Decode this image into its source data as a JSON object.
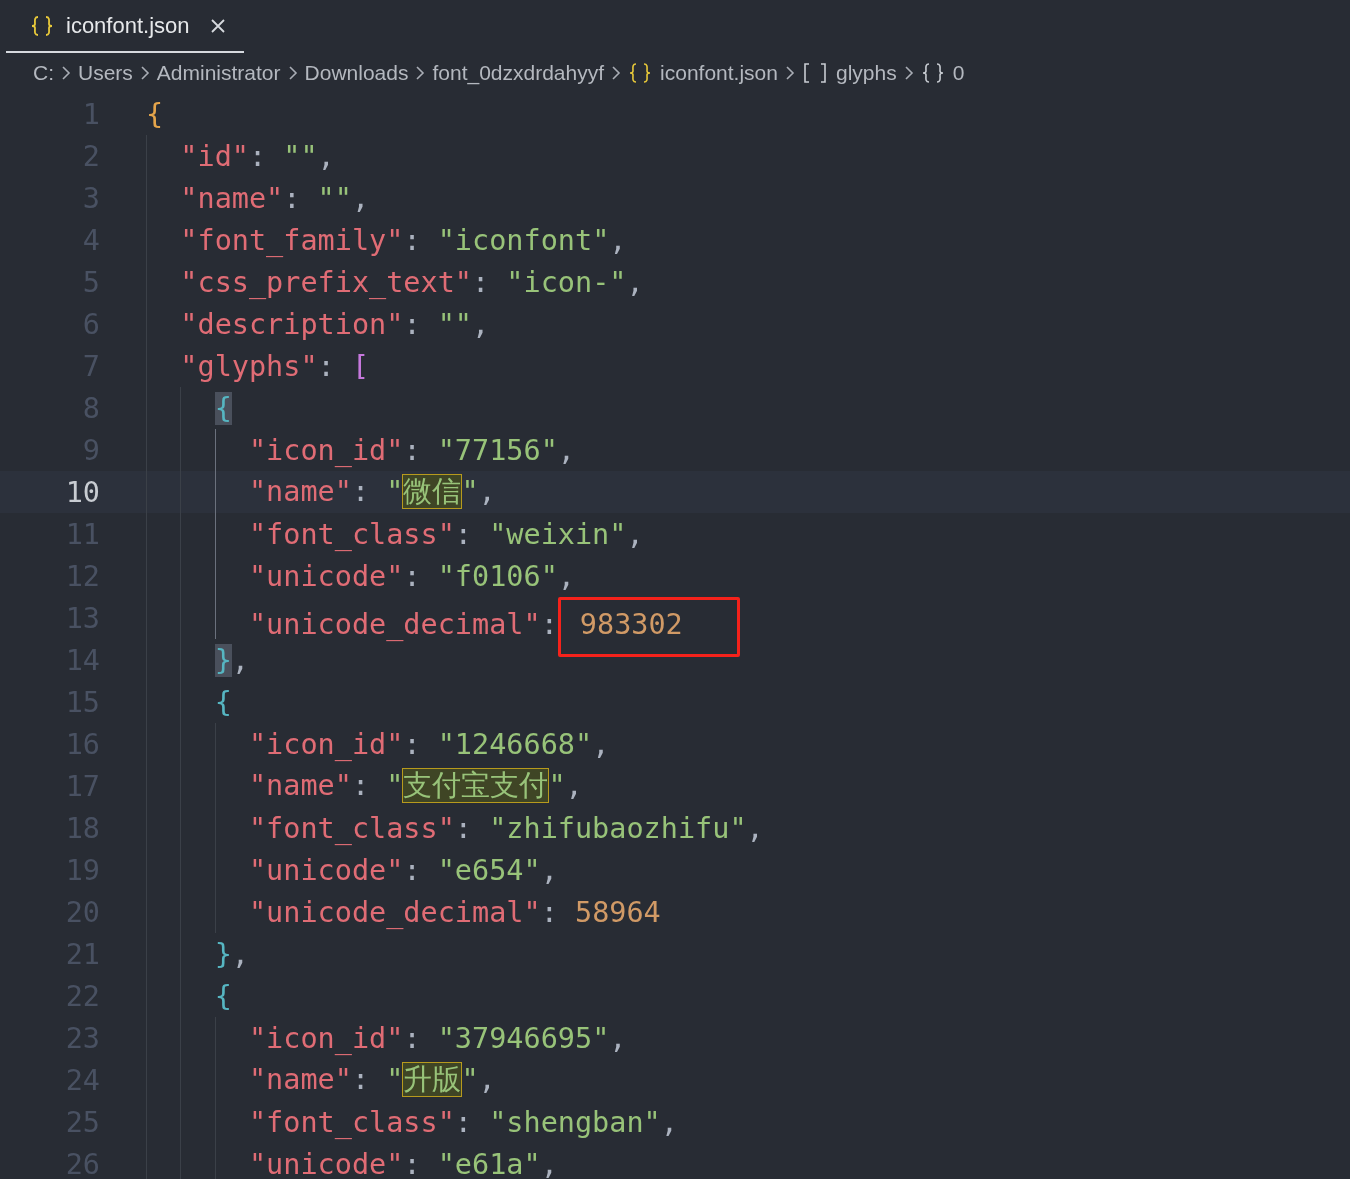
{
  "tab": {
    "title": "iconfont.json",
    "selected": true
  },
  "breadcrumbs": [
    {
      "kind": "plain",
      "label": "C:"
    },
    {
      "kind": "plain",
      "label": "Users"
    },
    {
      "kind": "plain",
      "label": "Administrator"
    },
    {
      "kind": "plain",
      "label": "Downloads"
    },
    {
      "kind": "plain",
      "label": "font_0dzxdrdahyyf"
    },
    {
      "kind": "file",
      "label": "iconfont.json"
    },
    {
      "kind": "array",
      "label": "glyphs"
    },
    {
      "kind": "object",
      "label": "0"
    }
  ],
  "lines": [
    {
      "number": "1",
      "current": false,
      "tokens": [
        {
          "kind": "open1",
          "text": "{"
        }
      ]
    },
    {
      "number": "2",
      "current": false,
      "tokens": [
        {
          "kind": "key",
          "text": "\"id\""
        },
        {
          "kind": "p",
          "text": ": "
        },
        {
          "kind": "str",
          "text": "\"\""
        },
        {
          "kind": "p",
          "text": ","
        }
      ]
    },
    {
      "number": "3",
      "current": false,
      "tokens": [
        {
          "kind": "key",
          "text": "\"name\""
        },
        {
          "kind": "p",
          "text": ": "
        },
        {
          "kind": "str",
          "text": "\"\""
        },
        {
          "kind": "p",
          "text": ","
        }
      ]
    },
    {
      "number": "4",
      "current": false,
      "tokens": [
        {
          "kind": "key",
          "text": "\"font_family\""
        },
        {
          "kind": "p",
          "text": ": "
        },
        {
          "kind": "str",
          "text": "\"iconfont\""
        },
        {
          "kind": "p",
          "text": ","
        }
      ]
    },
    {
      "number": "5",
      "current": false,
      "tokens": [
        {
          "kind": "key",
          "text": "\"css_prefix_text\""
        },
        {
          "kind": "p",
          "text": ": "
        },
        {
          "kind": "str",
          "text": "\"icon-\""
        },
        {
          "kind": "p",
          "text": ","
        }
      ]
    },
    {
      "number": "6",
      "current": false,
      "tokens": [
        {
          "kind": "key",
          "text": "\"description\""
        },
        {
          "kind": "p",
          "text": ": "
        },
        {
          "kind": "str",
          "text": "\"\""
        },
        {
          "kind": "p",
          "text": ","
        }
      ]
    },
    {
      "number": "7",
      "current": false,
      "tokens": [
        {
          "kind": "key",
          "text": "\"glyphs\""
        },
        {
          "kind": "p",
          "text": ": "
        },
        {
          "kind": "open2",
          "text": "["
        }
      ]
    },
    {
      "number": "8",
      "current": false,
      "tokens": [
        {
          "kind": "match_open",
          "text": "{"
        }
      ]
    },
    {
      "number": "9",
      "current": false,
      "tokens": [
        {
          "kind": "key",
          "text": "\"icon_id\""
        },
        {
          "kind": "p",
          "text": ": "
        },
        {
          "kind": "str",
          "text": "\"77156\""
        },
        {
          "kind": "p",
          "text": ","
        }
      ]
    },
    {
      "number": "10",
      "current": true,
      "tokens": [
        {
          "kind": "key",
          "text": "\"name\""
        },
        {
          "kind": "p",
          "text": ": "
        },
        {
          "kind": "str",
          "text": "\""
        },
        {
          "kind": "hl",
          "text": "微信"
        },
        {
          "kind": "str",
          "text": "\""
        },
        {
          "kind": "p",
          "text": ","
        }
      ]
    },
    {
      "number": "11",
      "current": false,
      "tokens": [
        {
          "kind": "key",
          "text": "\"font_class\""
        },
        {
          "kind": "p",
          "text": ": "
        },
        {
          "kind": "str",
          "text": "\"weixin\""
        },
        {
          "kind": "p",
          "text": ","
        }
      ]
    },
    {
      "number": "12",
      "current": false,
      "tokens": [
        {
          "kind": "key",
          "text": "\"unicode\""
        },
        {
          "kind": "p",
          "text": ": "
        },
        {
          "kind": "str",
          "text": "\"f0106\""
        },
        {
          "kind": "p",
          "text": ","
        }
      ]
    },
    {
      "number": "13",
      "current": false,
      "tokens": [
        {
          "kind": "key",
          "text": "\"unicode_decimal\""
        },
        {
          "kind": "p",
          "text": ":"
        },
        {
          "kind": "boxed",
          "text": "983302"
        }
      ]
    },
    {
      "number": "14",
      "current": false,
      "tokens": [
        {
          "kind": "match_close",
          "text": "}"
        },
        {
          "kind": "p",
          "text": ","
        }
      ]
    },
    {
      "number": "15",
      "current": false,
      "tokens": [
        {
          "kind": "open3",
          "text": "{"
        }
      ]
    },
    {
      "number": "16",
      "current": false,
      "tokens": [
        {
          "kind": "key",
          "text": "\"icon_id\""
        },
        {
          "kind": "p",
          "text": ": "
        },
        {
          "kind": "str",
          "text": "\"1246668\""
        },
        {
          "kind": "p",
          "text": ","
        }
      ]
    },
    {
      "number": "17",
      "current": false,
      "tokens": [
        {
          "kind": "key",
          "text": "\"name\""
        },
        {
          "kind": "p",
          "text": ": "
        },
        {
          "kind": "str",
          "text": "\""
        },
        {
          "kind": "hl",
          "text": "支付宝支付"
        },
        {
          "kind": "str",
          "text": "\""
        },
        {
          "kind": "p",
          "text": ","
        }
      ]
    },
    {
      "number": "18",
      "current": false,
      "tokens": [
        {
          "kind": "key",
          "text": "\"font_class\""
        },
        {
          "kind": "p",
          "text": ": "
        },
        {
          "kind": "str",
          "text": "\"zhifubaozhifu\""
        },
        {
          "kind": "p",
          "text": ","
        }
      ]
    },
    {
      "number": "19",
      "current": false,
      "tokens": [
        {
          "kind": "key",
          "text": "\"unicode\""
        },
        {
          "kind": "p",
          "text": ": "
        },
        {
          "kind": "str",
          "text": "\"e654\""
        },
        {
          "kind": "p",
          "text": ","
        }
      ]
    },
    {
      "number": "20",
      "current": false,
      "tokens": [
        {
          "kind": "key",
          "text": "\"unicode_decimal\""
        },
        {
          "kind": "p",
          "text": ": "
        },
        {
          "kind": "num",
          "text": "58964"
        }
      ]
    },
    {
      "number": "21",
      "current": false,
      "tokens": [
        {
          "kind": "close3",
          "text": "}"
        },
        {
          "kind": "p",
          "text": ","
        }
      ]
    },
    {
      "number": "22",
      "current": false,
      "tokens": [
        {
          "kind": "open3",
          "text": "{"
        }
      ]
    },
    {
      "number": "23",
      "current": false,
      "tokens": [
        {
          "kind": "key",
          "text": "\"icon_id\""
        },
        {
          "kind": "p",
          "text": ": "
        },
        {
          "kind": "str",
          "text": "\"37946695\""
        },
        {
          "kind": "p",
          "text": ","
        }
      ]
    },
    {
      "number": "24",
      "current": false,
      "tokens": [
        {
          "kind": "key",
          "text": "\"name\""
        },
        {
          "kind": "p",
          "text": ": "
        },
        {
          "kind": "str",
          "text": "\""
        },
        {
          "kind": "hl",
          "text": "升版"
        },
        {
          "kind": "str",
          "text": "\""
        },
        {
          "kind": "p",
          "text": ","
        }
      ]
    },
    {
      "number": "25",
      "current": false,
      "tokens": [
        {
          "kind": "key",
          "text": "\"font_class\""
        },
        {
          "kind": "p",
          "text": ": "
        },
        {
          "kind": "str",
          "text": "\"shengban\""
        },
        {
          "kind": "p",
          "text": ","
        }
      ]
    },
    {
      "number": "26",
      "current": false,
      "tokens": [
        {
          "kind": "key",
          "text": "\"unicode\""
        },
        {
          "kind": "p",
          "text": ": "
        },
        {
          "kind": "str",
          "text": "\"e61a\""
        },
        {
          "kind": "p",
          "text": ","
        }
      ]
    }
  ]
}
